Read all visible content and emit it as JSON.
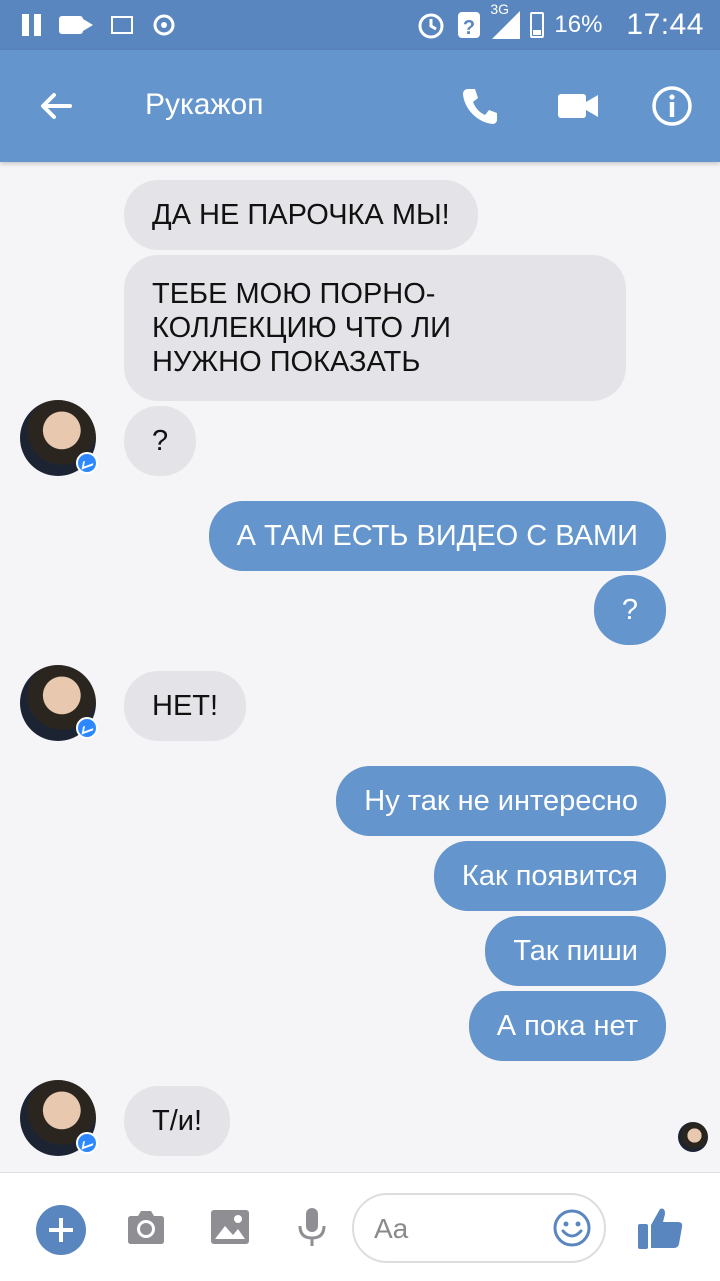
{
  "status_bar": {
    "network": "3G",
    "battery": "16%",
    "time": "17:44"
  },
  "header": {
    "contact_name": "Рукажоп"
  },
  "messages": [
    {
      "side": "in",
      "text": "ДА НЕ ПАРОЧКА МЫ!"
    },
    {
      "side": "in",
      "text": "ТЕБЕ МОЮ ПОРНО-\nКОЛЛЕКЦИЮ ЧТО ЛИ\nНУЖНО ПОКАЗАТЬ"
    },
    {
      "side": "in",
      "text": "?"
    },
    {
      "side": "out",
      "text": "А ТАМ ЕСТЬ ВИДЕО С ВАМИ"
    },
    {
      "side": "out",
      "text": "?"
    },
    {
      "side": "in",
      "text": "НЕТ!"
    },
    {
      "side": "out",
      "text": "Ну так не интересно"
    },
    {
      "side": "out",
      "text": "Как появится"
    },
    {
      "side": "out",
      "text": "Так пиши"
    },
    {
      "side": "out",
      "text": "А пока нет"
    },
    {
      "side": "in",
      "text": "Т/и!"
    }
  ],
  "composer": {
    "placeholder": "Aa"
  },
  "colors": {
    "header": "#6495cc",
    "status_bar": "#5a86c0",
    "outgoing_bubble": "#6495cc",
    "incoming_bubble": "#e4e4e8",
    "background": "#f5f5f7"
  },
  "icons": [
    "back-arrow-icon",
    "phone-icon",
    "video-camera-icon",
    "info-icon",
    "plus-icon",
    "camera-icon",
    "image-icon",
    "microphone-icon",
    "emoji-icon",
    "thumbs-up-icon",
    "messenger-badge-icon"
  ]
}
